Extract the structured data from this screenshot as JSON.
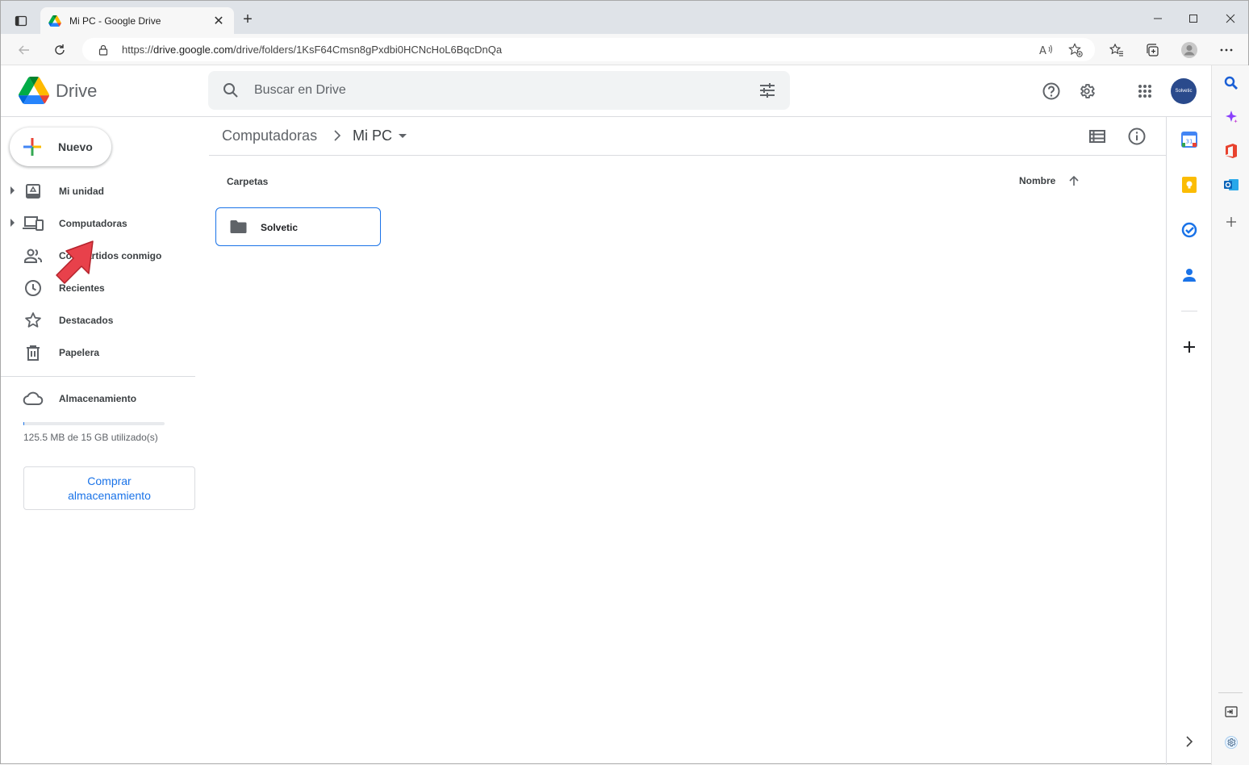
{
  "browser": {
    "tab_title": "Mi PC - Google Drive",
    "url_prefix": "https://",
    "url_domain": "drive.google.com",
    "url_path": "/drive/folders/1KsF64Cmsn8gPxdbi0HCNcHoL6BqcDnQa"
  },
  "header": {
    "brand": "Drive",
    "search_placeholder": "Buscar en Drive",
    "avatar_text": "Solvetic"
  },
  "sidebar": {
    "new_label": "Nuevo",
    "items": [
      {
        "label": "Mi unidad",
        "icon": "my-drive-icon",
        "expandable": true
      },
      {
        "label": "Computadoras",
        "icon": "computers-icon",
        "expandable": true
      },
      {
        "label": "Compartidos conmigo",
        "icon": "shared-icon",
        "expandable": false
      },
      {
        "label": "Recientes",
        "icon": "clock-icon",
        "expandable": false
      },
      {
        "label": "Destacados",
        "icon": "star-icon",
        "expandable": false
      },
      {
        "label": "Papelera",
        "icon": "trash-icon",
        "expandable": false
      }
    ],
    "storage_label": "Almacenamiento",
    "storage_text": "125.5 MB de 15 GB utilizado(s)",
    "storage_used_fraction": 0.008,
    "buy_label": "Comprar almacenamiento"
  },
  "main": {
    "breadcrumb_parent": "Computadoras",
    "breadcrumb_current": "Mi PC",
    "section_title": "Carpetas",
    "sort_label": "Nombre",
    "folders": [
      {
        "name": "Solvetic"
      }
    ]
  },
  "colors": {
    "accent": "#1a73e8",
    "pointer_arrow": "#e8414b"
  }
}
